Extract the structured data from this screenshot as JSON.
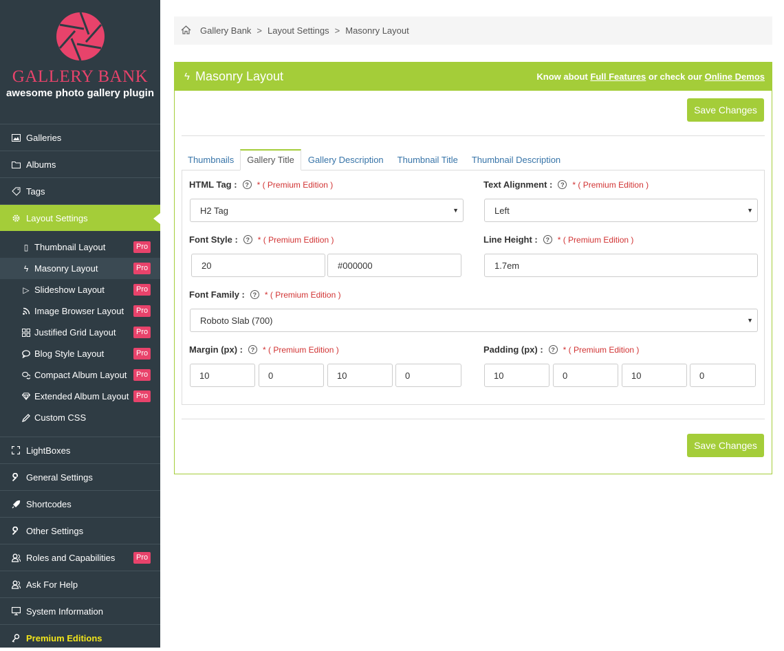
{
  "logo": {
    "title": "GALLERY BANK",
    "subtitle": "awesome photo gallery plugin"
  },
  "sidebar": {
    "items_top": [
      {
        "label": "Galleries",
        "icon": "image-icon"
      },
      {
        "label": "Albums",
        "icon": "folder-icon"
      },
      {
        "label": "Tags",
        "icon": "tag-icon"
      }
    ],
    "active": {
      "label": "Layout Settings",
      "icon": "gear-icon"
    },
    "sub": [
      {
        "label": "Thumbnail Layout",
        "icon": "phone-icon",
        "badge": "Pro"
      },
      {
        "label": "Masonry Layout",
        "icon": "bolt-icon",
        "badge": "Pro"
      },
      {
        "label": "Slideshow Layout",
        "icon": "play-icon",
        "badge": "Pro"
      },
      {
        "label": "Image Browser Layout",
        "icon": "rss-icon",
        "badge": "Pro"
      },
      {
        "label": "Justified Grid Layout",
        "icon": "grid-icon",
        "badge": "Pro"
      },
      {
        "label": "Blog Style Layout",
        "icon": "bubble-icon",
        "badge": "Pro"
      },
      {
        "label": "Compact Album Layout",
        "icon": "bubbles-icon",
        "badge": "Pro"
      },
      {
        "label": "Extended Album Layout",
        "icon": "diamond-icon",
        "badge": "Pro"
      },
      {
        "label": "Custom CSS",
        "icon": "pencil-icon"
      }
    ],
    "items_bottom": [
      {
        "label": "LightBoxes",
        "icon": "frame-icon"
      },
      {
        "label": "General Settings",
        "icon": "wrench-icon"
      },
      {
        "label": "Shortcodes",
        "icon": "rocket-icon"
      },
      {
        "label": "Other Settings",
        "icon": "wrench-icon"
      },
      {
        "label": "Roles and Capabilities",
        "icon": "users-icon",
        "badge": "Pro"
      },
      {
        "label": "Ask For Help",
        "icon": "users-icon"
      },
      {
        "label": "System Information",
        "icon": "monitor-icon"
      },
      {
        "label": "Premium Editions",
        "icon": "key-icon"
      }
    ]
  },
  "breadcrumb": {
    "home": "Gallery Bank",
    "sep": ">",
    "mid": "Layout Settings",
    "current": "Masonry Layout"
  },
  "panel": {
    "title": "Masonry Layout",
    "know_prefix": "Know about",
    "full_features": "Full Features",
    "or_check": "or check our",
    "online_demos": "Online Demos",
    "save": "Save Changes"
  },
  "tabs": [
    "Thumbnails",
    "Gallery Title",
    "Gallery Description",
    "Thumbnail Title",
    "Thumbnail Description"
  ],
  "form": {
    "premium": "* ( Premium Edition )",
    "html_tag": {
      "label": "HTML Tag :",
      "value": "H2 Tag"
    },
    "text_alignment": {
      "label": "Text Alignment :",
      "value": "Left"
    },
    "font_style": {
      "label": "Font Style :",
      "size": "20",
      "color": "#000000"
    },
    "line_height": {
      "label": "Line Height :",
      "value": "1.7em"
    },
    "font_family": {
      "label": "Font Family :",
      "value": "Roboto Slab (700)"
    },
    "margin": {
      "label": "Margin (px) :",
      "values": [
        "10",
        "0",
        "10",
        "0"
      ]
    },
    "padding": {
      "label": "Padding (px) :",
      "values": [
        "10",
        "0",
        "10",
        "0"
      ]
    }
  },
  "colors": {
    "accent": "#a4cd39",
    "sidebar": "#2f3c44",
    "brand": "#e8436b",
    "badge": "#e8436b",
    "premium_text": "#d13333"
  }
}
